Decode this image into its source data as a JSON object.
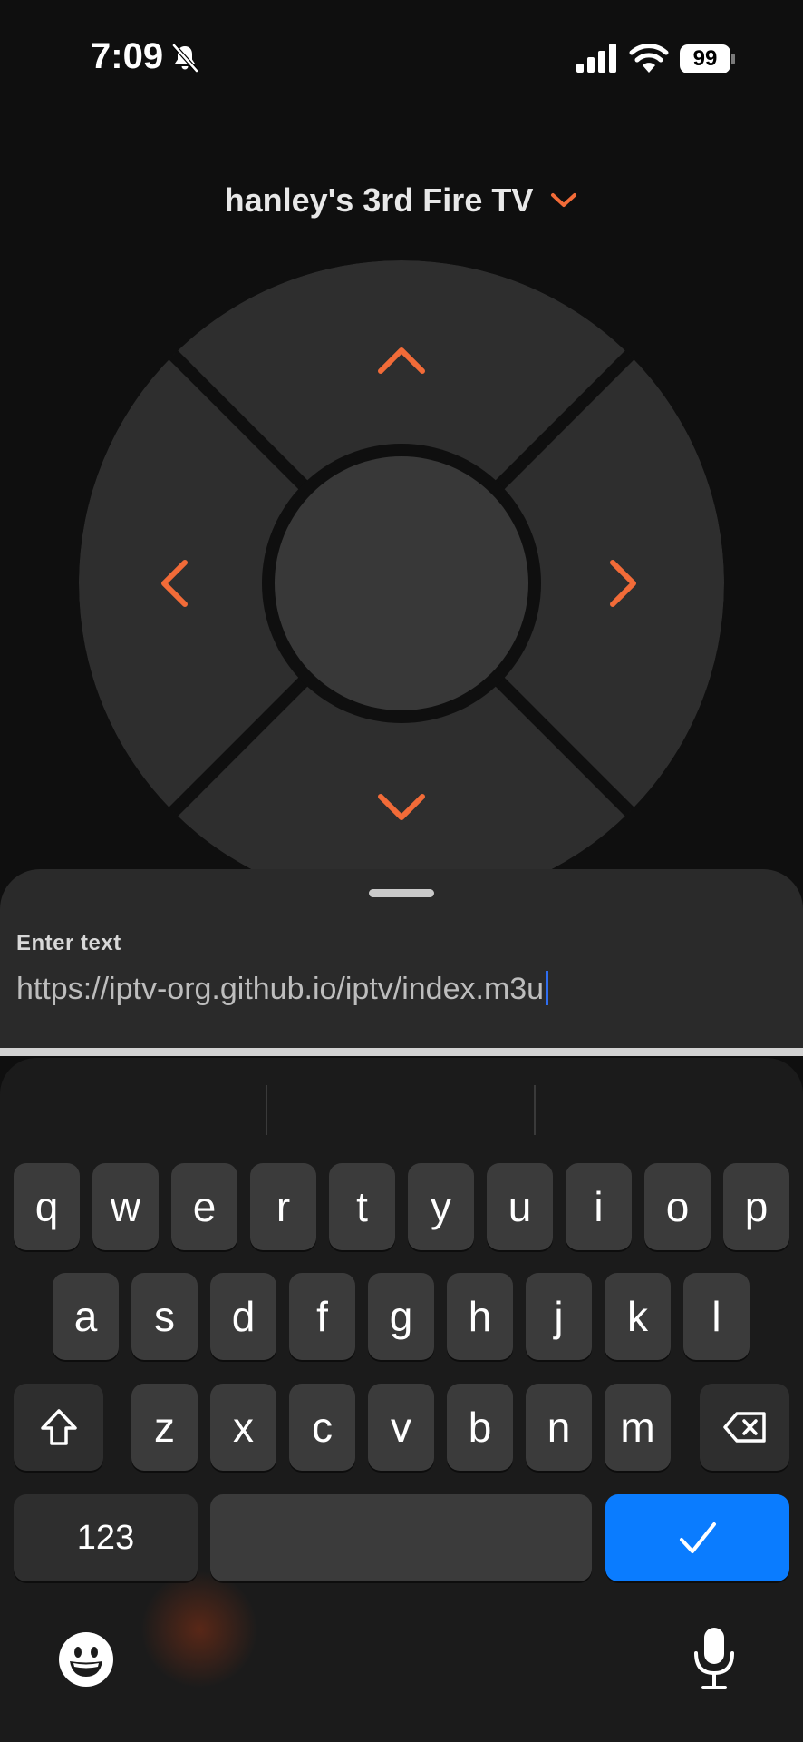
{
  "status_bar": {
    "time": "7:09",
    "battery_level": "99",
    "icons": [
      "bell-slash-icon",
      "cellular-signal-icon",
      "wifi-icon",
      "battery-icon"
    ]
  },
  "device": {
    "name": "hanley's 3rd Fire TV",
    "selector_icon": "chevron-down-icon"
  },
  "dpad": {
    "buttons": [
      "up",
      "down",
      "left",
      "right",
      "select"
    ],
    "accent_color": "#f26b38"
  },
  "text_entry": {
    "label": "Enter text",
    "value": "https://iptv-org.github.io/iptv/index.m3u"
  },
  "keyboard": {
    "row1": [
      "q",
      "w",
      "e",
      "r",
      "t",
      "y",
      "u",
      "i",
      "o",
      "p"
    ],
    "row2": [
      "a",
      "s",
      "d",
      "f",
      "g",
      "h",
      "j",
      "k",
      "l"
    ],
    "row3": [
      "z",
      "x",
      "c",
      "v",
      "b",
      "n",
      "m"
    ],
    "numbers_label": "123",
    "done_icon": "checkmark-icon",
    "done_color": "#0a7cff",
    "shift_icon": "shift-icon",
    "delete_icon": "delete-icon",
    "emoji_icon": "emoji-icon",
    "mic_icon": "microphone-icon"
  }
}
